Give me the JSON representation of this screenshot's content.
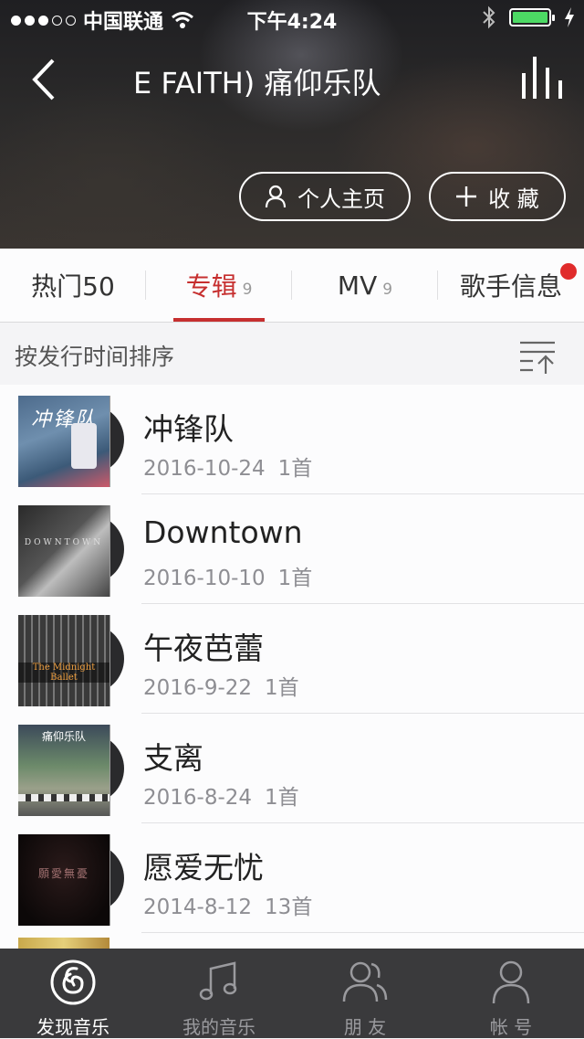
{
  "status_bar": {
    "carrier": "中国联通",
    "time": "下午4:24",
    "signal_full": 3,
    "signal_total": 5
  },
  "nav": {
    "title": "E FAITH)      痛仰乐队",
    "back_icon": "chevron-left-icon",
    "playing_icon": "equalizer-bars-icon"
  },
  "header_buttons": {
    "home_label": "个人主页",
    "favorite_label": "收 藏"
  },
  "tabs": [
    {
      "label": "热门50",
      "count": ""
    },
    {
      "label": "专辑",
      "count": "9"
    },
    {
      "label": "MV",
      "count": "9"
    },
    {
      "label": "歌手信息",
      "count": ""
    }
  ],
  "sort": {
    "label": "按发行时间排序"
  },
  "albums": [
    {
      "title": "冲锋队",
      "date": "2016-10-24",
      "tracks": "1首",
      "cover_text": "冲锋队"
    },
    {
      "title": "Downtown",
      "date": "2016-10-10",
      "tracks": "1首",
      "cover_text": "DOWNTOWN"
    },
    {
      "title": "午夜芭蕾",
      "date": "2016-9-22",
      "tracks": "1首",
      "cover_text": "The Midnight Ballet"
    },
    {
      "title": "支离",
      "date": "2016-8-24",
      "tracks": "1首",
      "cover_text": "痛仰乐队"
    },
    {
      "title": "愿爱无忧",
      "date": "2014-8-12",
      "tracks": "13首",
      "cover_text": "願愛無憂"
    }
  ],
  "bottom_tabs": [
    {
      "label": "发现音乐",
      "icon": "netease-music-icon"
    },
    {
      "label": "我的音乐",
      "icon": "music-note-icon"
    },
    {
      "label": "朋 友",
      "icon": "friends-icon"
    },
    {
      "label": "帐 号",
      "icon": "person-icon"
    }
  ],
  "colors": {
    "accent": "#c62f2f",
    "battery": "#4cd964",
    "bottom_bar": "#3a3a3c"
  }
}
